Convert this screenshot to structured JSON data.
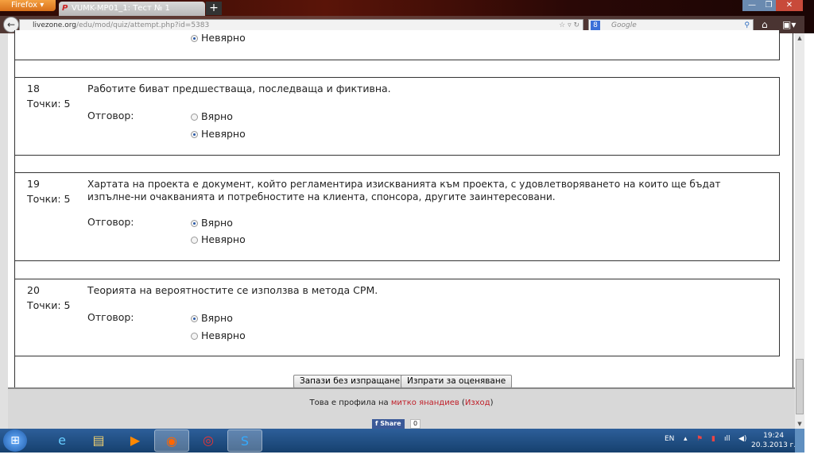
{
  "browser": {
    "menu_label": "Firefox",
    "tab_title": "VUMK-MP01_1: Тест № 1",
    "new_tab": "+",
    "url_domain": "livezone.org",
    "url_path": "/edu/mod/quiz/attempt.php?id=5383",
    "search_placeholder": "Google",
    "window_min": "—",
    "window_max": "❐",
    "window_close": "✕"
  },
  "quiz": {
    "answer_label": "Отговор:",
    "prev_option": "Невярно",
    "questions": [
      {
        "number": "18",
        "points": "Точки: 5",
        "text": "Работите биват предшестваща, последваща и фиктивна.",
        "options": [
          "Вярно",
          "Невярно"
        ],
        "selected": "Невярно"
      },
      {
        "number": "19",
        "points": "Точки: 5",
        "text": "Хартата на проекта е документ, който регламентира изискванията към проекта, с удовлетворяването на които ще бъдат изпълне-ни очакванията и потребностите на клиента, спонсора, другите заинтересовани.",
        "options": [
          "Вярно",
          "Невярно"
        ],
        "selected": "Вярно"
      },
      {
        "number": "20",
        "points": "Точки: 5",
        "text": "Теорията на вероятностите се използва в метода CPM.",
        "options": [
          "Вярно",
          "Невярно"
        ],
        "selected": "Вярно"
      }
    ],
    "save_button": "Запази без изпращане",
    "submit_button": "Изпрати за оценяване"
  },
  "footer": {
    "profile_text": "Това е профила на ",
    "user_name": "митко янандиев",
    "logout": "Изход",
    "share_label": "Share",
    "share_count": "0"
  },
  "taskbar": {
    "language": "EN",
    "time": "19:24",
    "date": "20.3.2013 г."
  }
}
